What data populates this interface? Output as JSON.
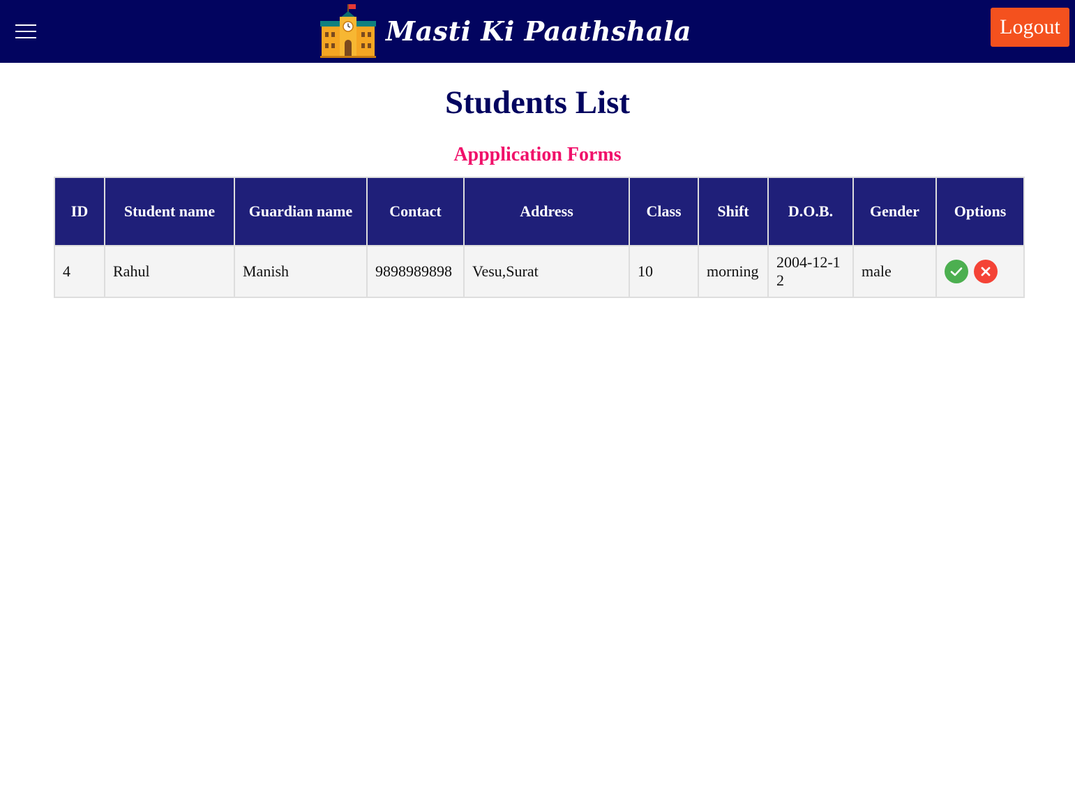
{
  "header": {
    "brand_name": "Masti Ki Paathshala",
    "logout_label": "Logout",
    "menu_icon": "hamburger-menu-icon",
    "logo_icon": "school-building-icon"
  },
  "page": {
    "title": "Students List",
    "section_title": "Appplication Forms"
  },
  "table": {
    "columns": [
      "ID",
      "Student name",
      "Guardian name",
      "Contact",
      "Address",
      "Class",
      "Shift",
      "D.O.B.",
      "Gender",
      "Options"
    ],
    "rows": [
      {
        "id": "4",
        "student_name": "Rahul",
        "guardian_name": "Manish",
        "contact": "9898989898",
        "address": "Vesu,Surat",
        "class": "10",
        "shift": "morning",
        "dob": "2004-12-12",
        "gender": "male",
        "options": [
          "approve-check-icon",
          "reject-x-icon"
        ]
      }
    ]
  },
  "colors": {
    "header_bg": "#02045f",
    "table_header_bg": "#1f1f79",
    "logout_bg": "#f4511e",
    "section_title": "#f0106a",
    "approve": "#4caf50",
    "reject": "#f44336"
  }
}
